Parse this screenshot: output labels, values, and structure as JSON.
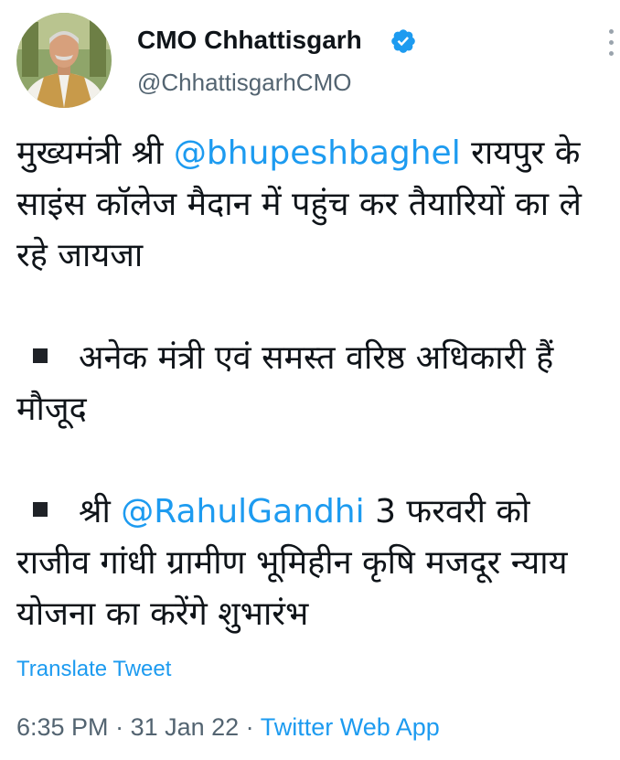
{
  "author": {
    "display_name": "CMO Chhattisgarh",
    "handle": "@ChhattisgarhCMO",
    "verified": true,
    "avatar_icon": "profile-photo",
    "verified_icon": "verified-badge-icon",
    "more_icon": "more-vertical-icon"
  },
  "tweet": {
    "p1_prefix": "मुख्यमंत्री श्री ",
    "p1_mention": "@bhupeshbaghel",
    "p1_suffix": " रायपुर के साइंस कॉलेज मैदान में पहुंच कर तैयारियों का ले रहे जायजा",
    "p2_text": "अनेक मंत्री एवं समस्त वरिष्ठ अधिकारी हैं मौजूद",
    "p3_prefix": "श्री ",
    "p3_mention": "@RahulGandhi",
    "p3_suffix": " 3 फरवरी को राजीव गांधी ग्रामीण भूमिहीन कृषि मजदूर न्याय योजना का करेंगे शुभारंभ"
  },
  "translate_label": "Translate Tweet",
  "meta": {
    "time": "6:35 PM",
    "separator": " · ",
    "date": "31 Jan 22",
    "source": "Twitter Web App"
  },
  "colors": {
    "link": "#1d9bf0",
    "text": "#0f1419",
    "secondary": "#536471"
  }
}
